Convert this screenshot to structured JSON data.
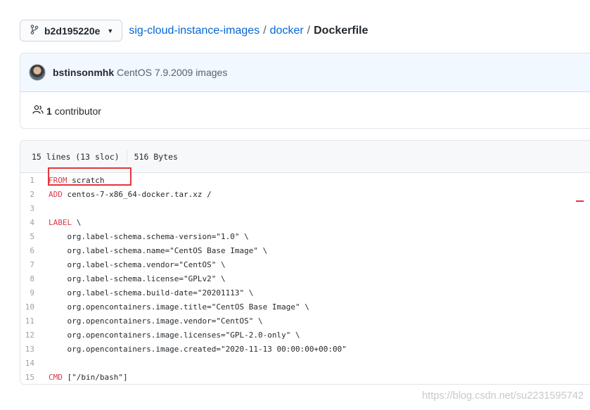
{
  "branch": {
    "label": "b2d195220e"
  },
  "breadcrumb": {
    "repo": "sig-cloud-instance-images",
    "folder": "docker",
    "file": "Dockerfile",
    "sep": "/"
  },
  "commit": {
    "author": "bstinsonmhk",
    "message": "CentOS 7.9.2009 images"
  },
  "contributors": {
    "count": "1",
    "label": "contributor"
  },
  "file": {
    "lines": "15 lines (13 sloc)",
    "size": "516 Bytes"
  },
  "code": [
    {
      "n": "1",
      "kw": "FROM",
      "rest": " scratch"
    },
    {
      "n": "2",
      "kw": "ADD",
      "rest": " centos-7-x86_64-docker.tar.xz /"
    },
    {
      "n": "3",
      "kw": "",
      "rest": ""
    },
    {
      "n": "4",
      "kw": "LABEL",
      "rest": " \\"
    },
    {
      "n": "5",
      "kw": "",
      "rest": "    org.label-schema.schema-version=\"1.0\" \\"
    },
    {
      "n": "6",
      "kw": "",
      "rest": "    org.label-schema.name=\"CentOS Base Image\" \\"
    },
    {
      "n": "7",
      "kw": "",
      "rest": "    org.label-schema.vendor=\"CentOS\" \\"
    },
    {
      "n": "8",
      "kw": "",
      "rest": "    org.label-schema.license=\"GPLv2\" \\"
    },
    {
      "n": "9",
      "kw": "",
      "rest": "    org.label-schema.build-date=\"20201113\" \\"
    },
    {
      "n": "10",
      "kw": "",
      "rest": "    org.opencontainers.image.title=\"CentOS Base Image\" \\"
    },
    {
      "n": "11",
      "kw": "",
      "rest": "    org.opencontainers.image.vendor=\"CentOS\" \\"
    },
    {
      "n": "12",
      "kw": "",
      "rest": "    org.opencontainers.image.licenses=\"GPL-2.0-only\" \\"
    },
    {
      "n": "13",
      "kw": "",
      "rest": "    org.opencontainers.image.created=\"2020-11-13 00:00:00+00:00\""
    },
    {
      "n": "14",
      "kw": "",
      "rest": ""
    },
    {
      "n": "15",
      "kw": "CMD",
      "rest": " [\"/bin/bash\"]"
    }
  ],
  "watermark": "https://blog.csdn.net/su2231595742",
  "colors": {
    "link": "#0366d6",
    "keyword": "#d73a49",
    "annotation": "#e5353b"
  }
}
